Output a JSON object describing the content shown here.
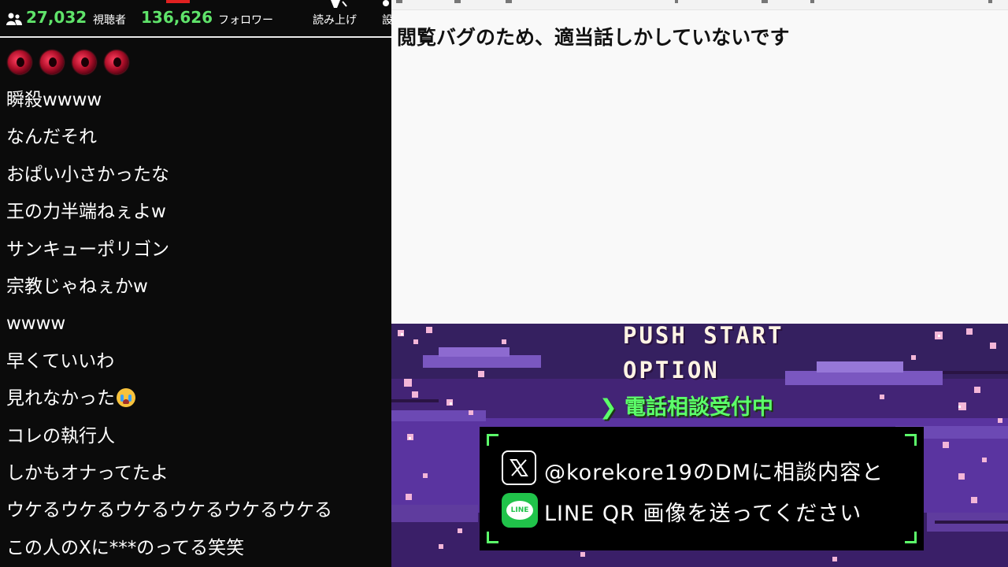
{
  "stats": {
    "viewers_count": "27,032",
    "viewers_label": "視聴者",
    "followers_count": "136,626",
    "followers_label": "フォロワー"
  },
  "toolbar": {
    "read_aloud_label": "読み上げ",
    "settings_label_partial": "設"
  },
  "colors": {
    "accent_green": "#5fe36a",
    "panel_bg": "#0b0b0b",
    "notepad_bg": "#f9f9f9",
    "dialog_corner": "#5cff6a"
  },
  "comments": [
    {
      "text": "瞬殺wwww"
    },
    {
      "text": "なんだそれ"
    },
    {
      "text": "おぱい小さかったな"
    },
    {
      "text": "王の力半端ねぇよw"
    },
    {
      "text": "サンキューポリゴン"
    },
    {
      "text": "宗教じゃねぇかw"
    },
    {
      "text": "wwww"
    },
    {
      "text": "早くていいわ"
    },
    {
      "text": "見れなかった",
      "emoji": "crying-face-icon"
    },
    {
      "text": "コレの執行人"
    },
    {
      "text": "しかもオナってたよ"
    },
    {
      "text": "ウケるウケるウケるウケるウケるウケる"
    },
    {
      "text": "この人のXに***のってる笑笑"
    }
  ],
  "notepad": {
    "text": "閲覧バグのため、適当話しかしていないです"
  },
  "art": {
    "push_start": "PUSH START",
    "option": "OPTION",
    "selected_option": "電話相談受付中",
    "selector_glyph": "❯",
    "dialog_line1": "@korekore19のDMに相談内容と",
    "dialog_line2": "LINE QR 画像を送ってください",
    "line_logo_text": "LINE"
  }
}
